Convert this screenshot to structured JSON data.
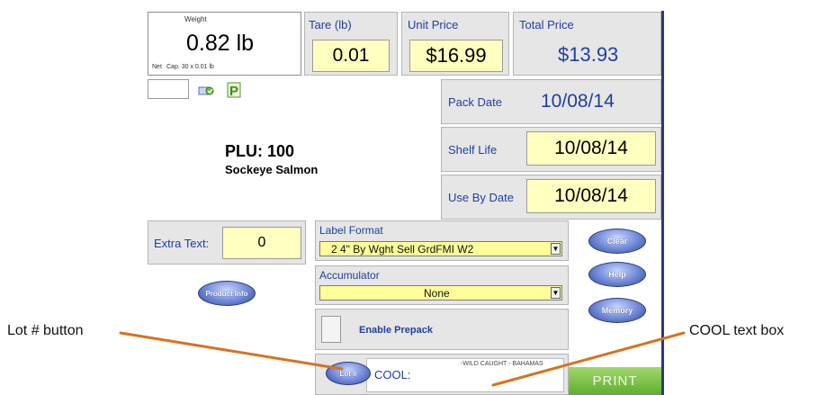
{
  "weight": {
    "label": "Weight",
    "value": "0.82 lb",
    "net": "Net",
    "capacity": "Cap. 30 x 0.01 lb"
  },
  "tare": {
    "label": "Tare (lb)",
    "value": "0.01"
  },
  "unit_price": {
    "label": "Unit Price",
    "value": "$16.99"
  },
  "total_price": {
    "label": "Total Price",
    "value": "$13.93"
  },
  "product": {
    "plu": "PLU: 100",
    "name": "Sockeye Salmon"
  },
  "dates": {
    "pack_label": "Pack Date",
    "pack_value": "10/08/14",
    "shelf_label": "Shelf Life",
    "shelf_value": "10/08/14",
    "useby_label": "Use By Date",
    "useby_value": "10/08/14"
  },
  "extra_text": {
    "label": "Extra Text:",
    "value": "0"
  },
  "label_format": {
    "label": "Label Format",
    "value": "2  4\"  By Wght Sell GrdFMI W2"
  },
  "accumulator": {
    "label": "Accumulator",
    "value": "None"
  },
  "prepack": {
    "label": "Enable Prepack"
  },
  "buttons": {
    "product_info": "Product Info",
    "clear": "Clear",
    "help": "Help",
    "memory": "Memory",
    "lot": "Lot #",
    "print": "PRINT"
  },
  "cool": {
    "label": "COOL:",
    "text": "-WILD CAUGHT - BAHAMAS"
  },
  "annotations": {
    "lot_button": "Lot # button",
    "cool_text_box": "COOL text box"
  },
  "colors": {
    "accent_blue": "#1f3fa0",
    "field_yellow": "#ffffc0",
    "print_green": "#7cc242",
    "callout_orange": "#d6741f"
  }
}
